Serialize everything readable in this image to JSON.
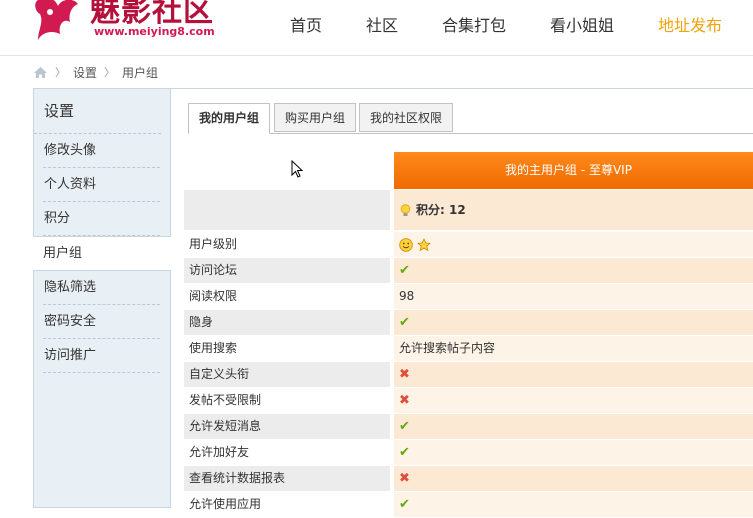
{
  "logo": {
    "text": "魅影社区",
    "url": "www.meiying8.com"
  },
  "nav": [
    {
      "label": "首页",
      "active": false
    },
    {
      "label": "社区",
      "active": false
    },
    {
      "label": "合集打包",
      "active": false
    },
    {
      "label": "看小姐姐",
      "active": false
    },
    {
      "label": "地址发布",
      "active": true
    }
  ],
  "breadcrumb": {
    "items": [
      "设置",
      "用户组"
    ]
  },
  "sidebar": {
    "title": "设置",
    "items": [
      {
        "label": "修改头像",
        "active": false
      },
      {
        "label": "个人资料",
        "active": false
      },
      {
        "label": "积分",
        "active": false
      },
      {
        "label": "用户组",
        "active": true
      },
      {
        "label": "隐私筛选",
        "active": false
      },
      {
        "label": "密码安全",
        "active": false
      },
      {
        "label": "访问推广",
        "active": false
      }
    ]
  },
  "tabs": [
    {
      "label": "我的用户组",
      "active": true
    },
    {
      "label": "购买用户组",
      "active": false
    },
    {
      "label": "我的社区权限",
      "active": false
    }
  ],
  "group": {
    "header": "我的主用户组 - 至尊VIP",
    "points_label": "积分: 12"
  },
  "permissions": [
    {
      "label": "用户级别",
      "type": "icons",
      "value": "smiley-icon star-icon"
    },
    {
      "label": "访问论坛",
      "type": "check"
    },
    {
      "label": "阅读权限",
      "type": "text",
      "value": "98"
    },
    {
      "label": "隐身",
      "type": "check"
    },
    {
      "label": "使用搜索",
      "type": "text",
      "value": "允许搜索帖子内容"
    },
    {
      "label": "自定义头衔",
      "type": "cross"
    },
    {
      "label": "发帖不受限制",
      "type": "cross"
    },
    {
      "label": "允许发短消息",
      "type": "check"
    },
    {
      "label": "允许加好友",
      "type": "check"
    },
    {
      "label": "查看统计数据报表",
      "type": "cross"
    },
    {
      "label": "允许使用应用",
      "type": "check"
    }
  ],
  "colors": {
    "accent": "#f07a0c",
    "nav_active": "#f0a30a",
    "check": "#64a80a",
    "cross": "#e04b3a"
  }
}
